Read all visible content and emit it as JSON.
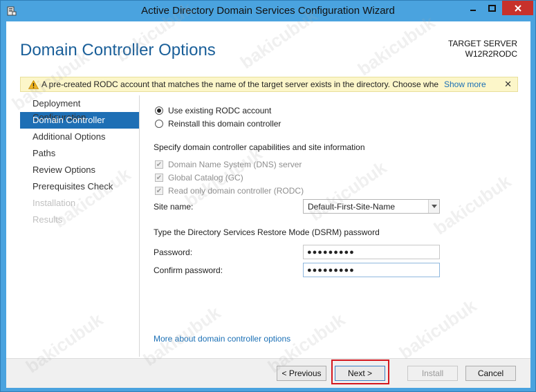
{
  "window": {
    "title": "Active Directory Domain Services Configuration Wizard"
  },
  "header": {
    "page_title": "Domain Controller Options",
    "target_label": "TARGET SERVER",
    "target_name": "W12R2RODC"
  },
  "warning": {
    "text": "A pre-created RODC account that matches the name of the target server exists in the directory.  Choose whether to use the existing RODC account or reinstall this domain controller.",
    "show_more": "Show more",
    "close": "✕"
  },
  "sidebar": {
    "items": [
      {
        "label": "Deployment Configuration",
        "state": "normal"
      },
      {
        "label": "Domain Controller Options",
        "state": "active"
      },
      {
        "label": "Additional Options",
        "state": "normal"
      },
      {
        "label": "Paths",
        "state": "normal"
      },
      {
        "label": "Review Options",
        "state": "normal"
      },
      {
        "label": "Prerequisites Check",
        "state": "normal"
      },
      {
        "label": "Installation",
        "state": "disabled"
      },
      {
        "label": "Results",
        "state": "disabled"
      }
    ]
  },
  "options": {
    "radio_existing": "Use existing RODC account",
    "radio_reinstall": "Reinstall this domain controller",
    "capabilities_heading": "Specify domain controller capabilities and site information",
    "check_dns": "Domain Name System (DNS) server",
    "check_gc": "Global Catalog (GC)",
    "check_rodc": "Read only domain controller (RODC)",
    "site_label": "Site name:",
    "site_value": "Default-First-Site-Name",
    "dsrm_heading": "Type the Directory Services Restore Mode (DSRM) password",
    "password_label": "Password:",
    "password_value": "●●●●●●●●●",
    "confirm_label": "Confirm password:",
    "confirm_value": "●●●●●●●●●",
    "more_link": "More about domain controller options"
  },
  "buttons": {
    "previous": "< Previous",
    "next": "Next >",
    "install": "Install",
    "cancel": "Cancel"
  },
  "watermark": "bakicubuk"
}
